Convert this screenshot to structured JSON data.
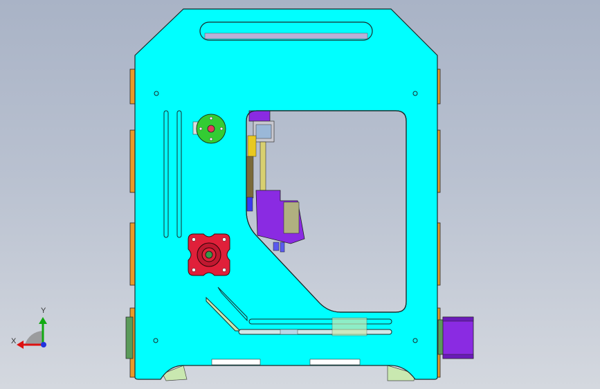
{
  "app": {
    "title": ""
  },
  "triad": {
    "x_label": "X",
    "y_label": "Y"
  },
  "colors": {
    "frame": "#00ffff",
    "frame_outline": "#1a2a2a",
    "side_panel": "#e89a2a",
    "motor_mount": "#e0203a",
    "pulley": "#33cc33",
    "carriage": "#9a33ee",
    "stepper": "#8a2be2",
    "background_top": "#a9b3c6",
    "background_bottom": "#d4d8df"
  },
  "icons": {
    "triad": "xyz-axis-triad-icon"
  }
}
